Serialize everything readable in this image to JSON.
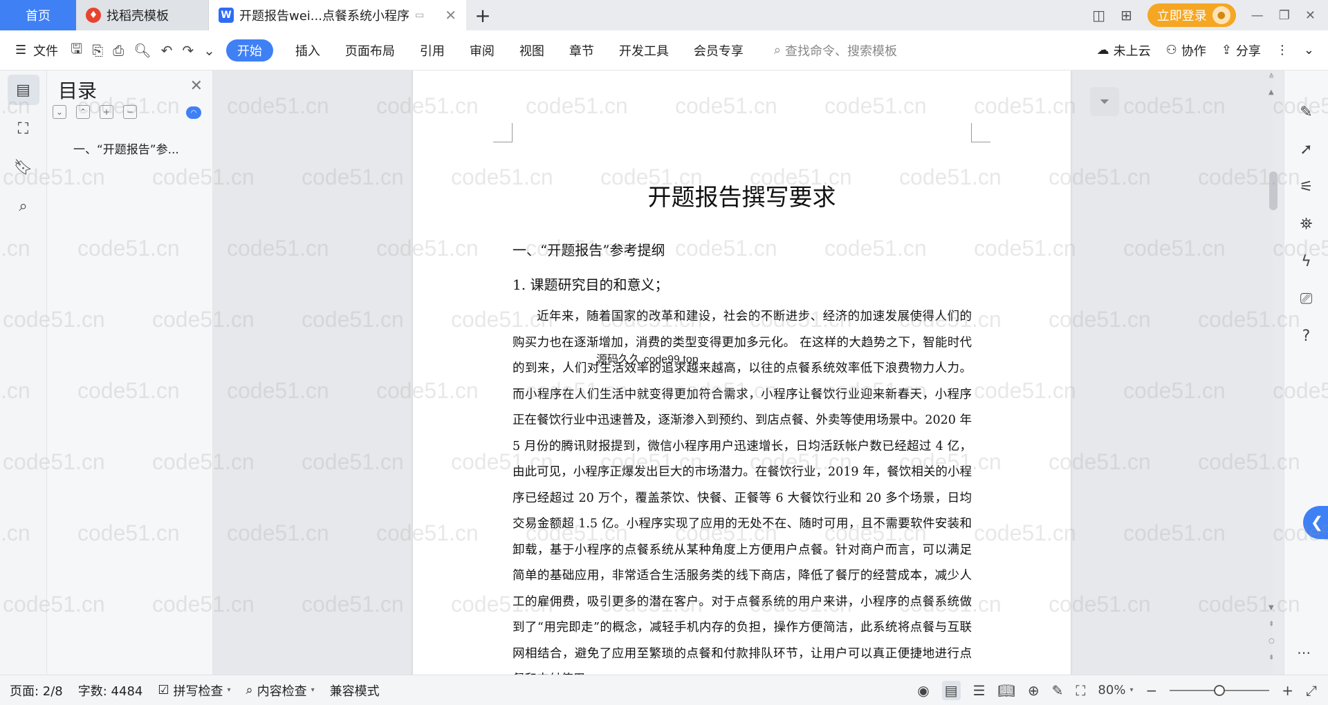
{
  "tabs": {
    "home": "首页",
    "items": [
      {
        "label": "找稻壳模板",
        "icon": "docer-icon"
      },
      {
        "label": "开题报告wei...点餐系统小程序",
        "icon": "wps-writer-icon"
      }
    ],
    "add": "+",
    "login": "立即登录"
  },
  "menu": {
    "file": "文件",
    "items": [
      "开始",
      "插入",
      "页面布局",
      "引用",
      "审阅",
      "视图",
      "章节",
      "开发工具",
      "会员专享"
    ],
    "active_index": 0,
    "search_placeholder": "查找命令、搜索模板",
    "right": {
      "cloud": "未上云",
      "collab": "协作",
      "share": "分享"
    }
  },
  "toc": {
    "title": "目录",
    "items": [
      "一、“开题报告”参..."
    ]
  },
  "document": {
    "title": "开题报告撰写要求",
    "heading1": "一、“开题报告”参考提纲",
    "heading2": "1. 课题研究目的和意义；",
    "body": "近年来，随着国家的改革和建设，社会的不断进步、经济的加速发展使得人们的购买力也在逐渐增加，消费的类型变得更加多元化。 在这样的大趋势之下，智能时代的到来，人们对生活效率的追求越来越高，以往的点餐系统效率低下浪费物力人力。而小程序在人们生活中就变得更加符合需求，小程序让餐饮行业迎来新春天，小程序正在餐饮行业中迅速普及，逐渐渗入到预约、到店点餐、外卖等使用场景中。2020 年 5 月份的腾讯财报提到，微信小程序用户迅速增长，日均活跃帐户数已经超过 4 亿，由此可见，小程序正爆发出巨大的市场潜力。在餐饮行业，2019 年，餐饮相关的小程序已经超过 20 万个，覆盖茶饮、快餐、正餐等 6 大餐饮行业和 20 多个场景，日均交易金额超 1.5 亿。小程序实现了应用的无处不在、随时可用，且不需要软件安装和卸载，基于小程序的点餐系统从某种角度上方便用户点餐。针对商户而言，可以满足简单的基础应用，非常适合生活服务类的线下商店，降低了餐厅的经营成本，减少人工的雇佣费，吸引更多的潜在客户。对于点餐系统的用户来讲，小程序的点餐系统做到了“用完即走”的概念，减轻手机内存的负担，操作方便简洁，此系统将点餐与互联网相结合，避免了应用至繁琐的点餐和付款排队环节，让用户可以真正便捷地进行点餐和支付使用",
    "inline_watermark": "源码久久 code99.top"
  },
  "watermark": "code51.cn",
  "status": {
    "page": "页面: 2/8",
    "words": "字数: 4484",
    "spell": "拼写检查",
    "content": "内容检查",
    "compat": "兼容模式",
    "zoom": "80%",
    "zoom_level": 0.5
  }
}
